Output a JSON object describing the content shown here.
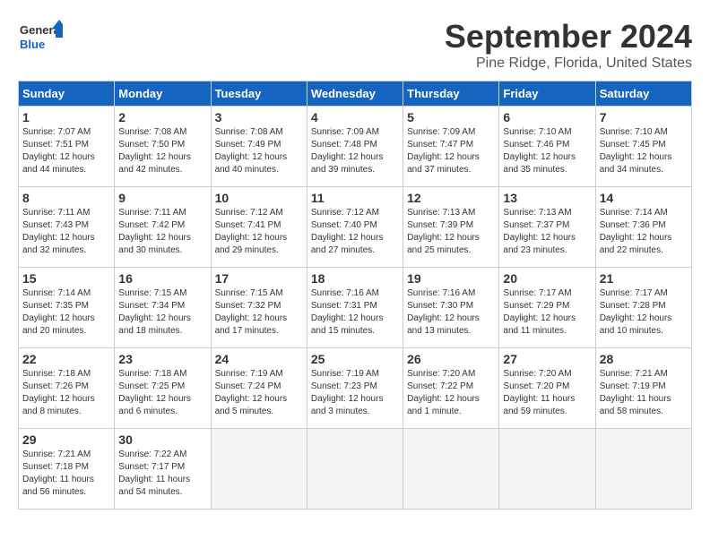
{
  "header": {
    "logo_general": "General",
    "logo_blue": "Blue",
    "month_title": "September 2024",
    "location": "Pine Ridge, Florida, United States"
  },
  "days_of_week": [
    "Sunday",
    "Monday",
    "Tuesday",
    "Wednesday",
    "Thursday",
    "Friday",
    "Saturday"
  ],
  "weeks": [
    [
      {
        "day": 1,
        "sunrise": "7:07 AM",
        "sunset": "7:51 PM",
        "daylight": "12 hours and 44 minutes."
      },
      {
        "day": 2,
        "sunrise": "7:08 AM",
        "sunset": "7:50 PM",
        "daylight": "12 hours and 42 minutes."
      },
      {
        "day": 3,
        "sunrise": "7:08 AM",
        "sunset": "7:49 PM",
        "daylight": "12 hours and 40 minutes."
      },
      {
        "day": 4,
        "sunrise": "7:09 AM",
        "sunset": "7:48 PM",
        "daylight": "12 hours and 39 minutes."
      },
      {
        "day": 5,
        "sunrise": "7:09 AM",
        "sunset": "7:47 PM",
        "daylight": "12 hours and 37 minutes."
      },
      {
        "day": 6,
        "sunrise": "7:10 AM",
        "sunset": "7:46 PM",
        "daylight": "12 hours and 35 minutes."
      },
      {
        "day": 7,
        "sunrise": "7:10 AM",
        "sunset": "7:45 PM",
        "daylight": "12 hours and 34 minutes."
      }
    ],
    [
      {
        "day": 8,
        "sunrise": "7:11 AM",
        "sunset": "7:43 PM",
        "daylight": "12 hours and 32 minutes."
      },
      {
        "day": 9,
        "sunrise": "7:11 AM",
        "sunset": "7:42 PM",
        "daylight": "12 hours and 30 minutes."
      },
      {
        "day": 10,
        "sunrise": "7:12 AM",
        "sunset": "7:41 PM",
        "daylight": "12 hours and 29 minutes."
      },
      {
        "day": 11,
        "sunrise": "7:12 AM",
        "sunset": "7:40 PM",
        "daylight": "12 hours and 27 minutes."
      },
      {
        "day": 12,
        "sunrise": "7:13 AM",
        "sunset": "7:39 PM",
        "daylight": "12 hours and 25 minutes."
      },
      {
        "day": 13,
        "sunrise": "7:13 AM",
        "sunset": "7:37 PM",
        "daylight": "12 hours and 23 minutes."
      },
      {
        "day": 14,
        "sunrise": "7:14 AM",
        "sunset": "7:36 PM",
        "daylight": "12 hours and 22 minutes."
      }
    ],
    [
      {
        "day": 15,
        "sunrise": "7:14 AM",
        "sunset": "7:35 PM",
        "daylight": "12 hours and 20 minutes."
      },
      {
        "day": 16,
        "sunrise": "7:15 AM",
        "sunset": "7:34 PM",
        "daylight": "12 hours and 18 minutes."
      },
      {
        "day": 17,
        "sunrise": "7:15 AM",
        "sunset": "7:32 PM",
        "daylight": "12 hours and 17 minutes."
      },
      {
        "day": 18,
        "sunrise": "7:16 AM",
        "sunset": "7:31 PM",
        "daylight": "12 hours and 15 minutes."
      },
      {
        "day": 19,
        "sunrise": "7:16 AM",
        "sunset": "7:30 PM",
        "daylight": "12 hours and 13 minutes."
      },
      {
        "day": 20,
        "sunrise": "7:17 AM",
        "sunset": "7:29 PM",
        "daylight": "12 hours and 11 minutes."
      },
      {
        "day": 21,
        "sunrise": "7:17 AM",
        "sunset": "7:28 PM",
        "daylight": "12 hours and 10 minutes."
      }
    ],
    [
      {
        "day": 22,
        "sunrise": "7:18 AM",
        "sunset": "7:26 PM",
        "daylight": "12 hours and 8 minutes."
      },
      {
        "day": 23,
        "sunrise": "7:18 AM",
        "sunset": "7:25 PM",
        "daylight": "12 hours and 6 minutes."
      },
      {
        "day": 24,
        "sunrise": "7:19 AM",
        "sunset": "7:24 PM",
        "daylight": "12 hours and 5 minutes."
      },
      {
        "day": 25,
        "sunrise": "7:19 AM",
        "sunset": "7:23 PM",
        "daylight": "12 hours and 3 minutes."
      },
      {
        "day": 26,
        "sunrise": "7:20 AM",
        "sunset": "7:22 PM",
        "daylight": "12 hours and 1 minute."
      },
      {
        "day": 27,
        "sunrise": "7:20 AM",
        "sunset": "7:20 PM",
        "daylight": "11 hours and 59 minutes."
      },
      {
        "day": 28,
        "sunrise": "7:21 AM",
        "sunset": "7:19 PM",
        "daylight": "11 hours and 58 minutes."
      }
    ],
    [
      {
        "day": 29,
        "sunrise": "7:21 AM",
        "sunset": "7:18 PM",
        "daylight": "11 hours and 56 minutes."
      },
      {
        "day": 30,
        "sunrise": "7:22 AM",
        "sunset": "7:17 PM",
        "daylight": "11 hours and 54 minutes."
      },
      null,
      null,
      null,
      null,
      null
    ]
  ]
}
